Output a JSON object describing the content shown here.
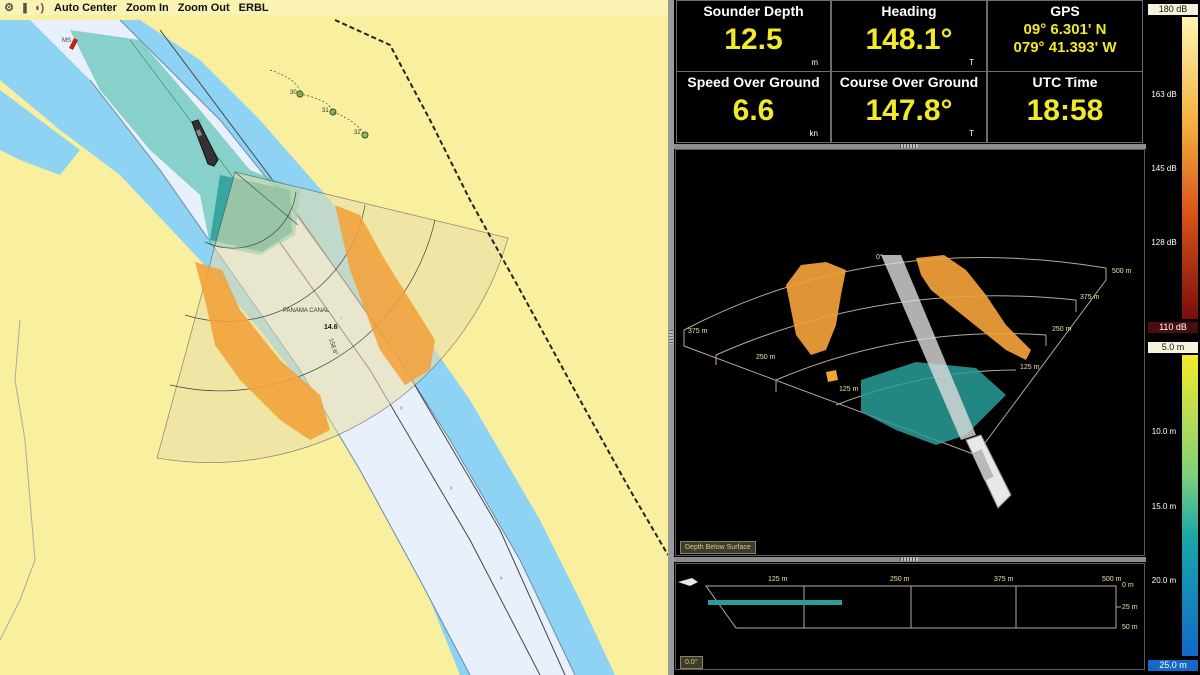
{
  "toolbar": {
    "icons": [
      "settings-icon",
      "bars-icon",
      "sound-icon"
    ],
    "buttons": [
      "Auto Center",
      "Zoom In",
      "Zoom Out",
      "ERBL"
    ]
  },
  "chart_map": {
    "canal_label": "PANAMA CANAL",
    "depth_sounding": "14.6",
    "heading_label": "158.6°",
    "buoys": [
      "30",
      "31",
      "32"
    ],
    "vessel_label": "MS"
  },
  "instruments": {
    "sounder_depth": {
      "label": "Sounder Depth",
      "value": "12.5",
      "unit": "m"
    },
    "heading": {
      "label": "Heading",
      "value": "148.1°",
      "unit": "T"
    },
    "gps": {
      "label": "GPS",
      "lat": "09° 6.301' N",
      "lon": "079° 41.393' W"
    },
    "sog": {
      "label": "Speed Over Ground",
      "value": "6.6",
      "unit": "kn"
    },
    "cog": {
      "label": "Course Over Ground",
      "value": "147.8°",
      "unit": "T"
    },
    "utc": {
      "label": "UTC Time",
      "value": "18:58"
    }
  },
  "view3d": {
    "ranges_right": [
      "500 m",
      "375 m",
      "250 m",
      "125 m"
    ],
    "ranges_left": [
      "375 m",
      "250 m",
      "125 m"
    ],
    "bearing": "0°",
    "mode_button": "Depth Below Surface"
  },
  "profile": {
    "ranges": [
      "125 m",
      "250 m",
      "375 m",
      "500 m"
    ],
    "depths": [
      "0 m",
      "25 m",
      "50 m"
    ],
    "angle_button": "0.0°"
  },
  "scales": {
    "db": {
      "max": "180 dB",
      "min": "110 dB",
      "ticks": [
        "163 dB",
        "145 dB",
        "128 dB"
      ]
    },
    "depth": {
      "min": "5.0 m",
      "max": "25.0 m",
      "ticks": [
        "10.0 m",
        "15.0 m",
        "20.0 m"
      ]
    }
  },
  "colors": {
    "land": "#f8ef9f",
    "deep_water": "#8fd3f4",
    "channel": "#e8f1fb",
    "readout": "#f0ea2a",
    "target": "#f2a23a",
    "seabed": "#2a9d9a"
  }
}
